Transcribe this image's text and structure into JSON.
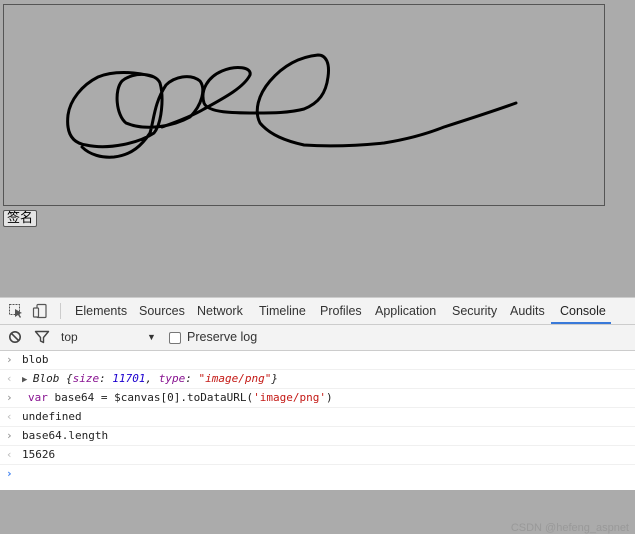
{
  "page": {
    "sign_button_label": "签名"
  },
  "devtools": {
    "tabs": [
      "Elements",
      "Sources",
      "Network",
      "Timeline",
      "Profiles",
      "Application",
      "Security",
      "Audits",
      "Console"
    ],
    "active_tab": "Console",
    "accent_color": "#3879d9",
    "context": "top",
    "preserve_log_label": "Preserve log"
  },
  "console": {
    "lines": [
      {
        "kind": "input",
        "text": "blob"
      },
      {
        "kind": "output",
        "object_name": "Blob",
        "brace_open": "{",
        "key1": "size",
        "sep1": ": ",
        "val1": "11701",
        "comma": ", ",
        "key2": "type",
        "sep2": ": ",
        "val2": "\"image/png\"",
        "brace_close": "}"
      },
      {
        "kind": "input",
        "keyword": "var",
        "rest_before": " base64 = $canvas[0].toDataURL(",
        "string": "'image/png'",
        "rest_after": ")"
      },
      {
        "kind": "result",
        "text": "undefined"
      },
      {
        "kind": "input",
        "text": "base64.length"
      },
      {
        "kind": "result",
        "text": "15626"
      }
    ]
  },
  "watermark": "CSDN @hefeng_aspnet"
}
